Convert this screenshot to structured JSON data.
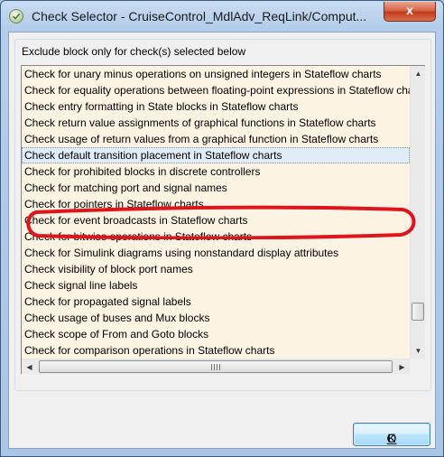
{
  "window": {
    "title": "Check Selector - CruiseControl_MdlAdv_ReqLink/Comput...",
    "close_label": "x"
  },
  "group": {
    "label": "Exclude block only for check(s) selected below"
  },
  "checks": {
    "items": [
      "Check for unary minus operations on unsigned integers in Stateflow charts",
      "Check for equality operations between floating-point expressions in Stateflow charts",
      "Check entry formatting in State blocks in Stateflow charts",
      "Check return value assignments of graphical functions in Stateflow charts",
      "Check usage of return values from a graphical function in Stateflow charts",
      "Check default transition placement in Stateflow charts",
      "Check for prohibited blocks in discrete controllers",
      "Check for matching port and signal names",
      "Check for pointers in Stateflow charts",
      "Check for event broadcasts in Stateflow charts",
      "Check for bitwise operations in Stateflow charts",
      "Check for Simulink diagrams using nonstandard display attributes",
      "Check visibility of block port names",
      "Check signal line labels",
      "Check for propagated signal labels",
      "Check usage of buses and Mux blocks",
      "Check scope of From and Goto blocks",
      "Check for comparison operations in Stateflow charts"
    ],
    "selected_index": 5,
    "list_background": "#fdf3e3",
    "selection_background": "#e2ecf7"
  },
  "annotation": {
    "color": "#e0141b"
  },
  "buttons": {
    "ok_label_underlined": "O",
    "ok_label_rest": "K"
  },
  "icons": {
    "app": "check-selector-icon",
    "close": "close-icon",
    "scroll_up": "arrow-up-icon",
    "scroll_down": "arrow-down-icon",
    "scroll_left": "arrow-left-icon",
    "scroll_right": "arrow-right-icon"
  }
}
